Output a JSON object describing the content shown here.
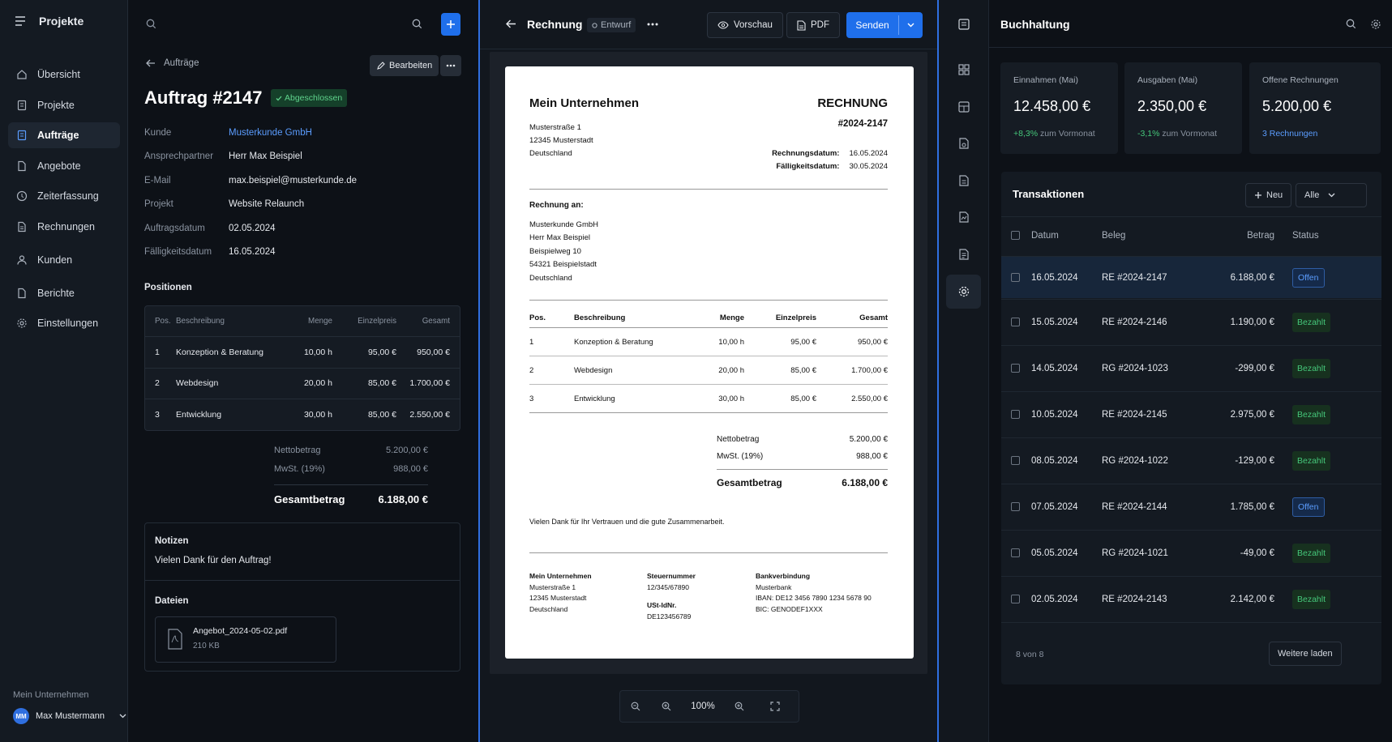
{
  "sidebar": {
    "title": "Projekte",
    "items": [
      {
        "label": "Übersicht",
        "icon": "home-icon"
      },
      {
        "label": "Projekte",
        "icon": "folder-icon"
      },
      {
        "label": "Aufträge",
        "icon": "order-icon"
      },
      {
        "label": "Angebote",
        "icon": "document-icon"
      },
      {
        "label": "Zeiterfassung",
        "icon": "clock-icon"
      },
      {
        "label": "Rechnungen",
        "icon": "invoice-icon"
      },
      {
        "label": "Kunden",
        "icon": "users-icon"
      },
      {
        "label": "Berichte",
        "icon": "report-icon"
      },
      {
        "label": "Einstellungen",
        "icon": "gear-icon"
      }
    ],
    "company": "Mein Unternehmen",
    "user_initials": "MM",
    "user_name": "Max Mustermann"
  },
  "order": {
    "back_label": "Aufträge",
    "edit_label": "Bearbeiten",
    "title": "Auftrag #2147",
    "status": "Abgeschlossen",
    "fields": [
      {
        "key": "Kunde",
        "value": "Musterkunde GmbH"
      },
      {
        "key": "Ansprechpartner",
        "value": "Herr Max Beispiel"
      },
      {
        "key": "E-Mail",
        "value": "max.beispiel@musterkunde.de"
      },
      {
        "key": "Projekt",
        "value": "Website Relaunch"
      },
      {
        "key": "Auftragsdatum",
        "value": "02.05.2024"
      },
      {
        "key": "Fälligkeitsdatum",
        "value": "16.05.2024"
      }
    ],
    "positions_title": "Positionen",
    "table_headers": [
      "Pos.",
      "Beschreibung",
      "Menge",
      "Einzelpreis",
      "Gesamt"
    ],
    "rows": [
      [
        "1",
        "Konzeption & Beratung",
        "10,00 h",
        "95,00 €",
        "950,00 €"
      ],
      [
        "2",
        "Webdesign",
        "20,00 h",
        "85,00 €",
        "1.700,00 €"
      ],
      [
        "3",
        "Entwicklung",
        "30,00 h",
        "85,00 €",
        "2.550,00 €"
      ]
    ],
    "net_label": "Nettobetrag",
    "net_value": "5.200,00 €",
    "vat_label": "MwSt. (19%)",
    "vat_value": "988,00 €",
    "total_label": "Gesamtbetrag",
    "total_value": "6.188,00 €",
    "notes_title": "Notizen",
    "notes_text": "Vielen Dank für den Auftrag!",
    "files_title": "Dateien",
    "file_name": "Angebot_2024-05-02.pdf",
    "file_size": "210 KB"
  },
  "document": {
    "title": "Rechnung",
    "status": "Entwurf",
    "preview_label": "Vorschau",
    "pdf_label": "PDF",
    "send_label": "Senden",
    "zoom": "100%",
    "invoice": {
      "company": "Mein Unternehmen",
      "address": [
        "Musterstraße 1",
        "12345 Musterstadt",
        "Deutschland"
      ],
      "heading": "RECHNUNG",
      "number": "#2024-2147",
      "date_label": "Rechnungsdatum:",
      "date_value": "16.05.2024",
      "due_label": "Fälligkeitsdatum:",
      "due_value": "30.05.2024",
      "to_label": "Rechnung an:",
      "recipient": [
        "Musterkunde GmbH",
        "Herr Max Beispiel",
        "Beispielweg 10",
        "54321 Beispielstadt",
        "Deutschland"
      ],
      "headers": [
        "Pos.",
        "Beschreibung",
        "Menge",
        "Einzelpreis",
        "Gesamt"
      ],
      "rows": [
        [
          "1",
          "Konzeption & Beratung",
          "10,00 h",
          "95,00 €",
          "950,00 €"
        ],
        [
          "2",
          "Webdesign",
          "20,00 h",
          "85,00 €",
          "1.700,00 €"
        ],
        [
          "3",
          "Entwicklung",
          "30,00 h",
          "85,00 €",
          "2.550,00 €"
        ]
      ],
      "net_label": "Nettobetrag",
      "net_value": "5.200,00 €",
      "vat_label": "MwSt. (19%)",
      "vat_value": "988,00 €",
      "total_label": "Gesamtbetrag",
      "total_value": "6.188,00 €",
      "thanks": "Vielen Dank für Ihr Vertrauen und die gute Zusammenarbeit.",
      "footer_company": "Mein Unternehmen",
      "footer_address": [
        "Musterstraße 1",
        "12345 Musterstadt",
        "Deutschland"
      ],
      "tax_label": "Steuernummer",
      "tax_value": "12/345/67890",
      "vatid_label": "USt-IdNr.",
      "vatid_value": "DE123456789",
      "bank_label": "Bankverbindung",
      "bank_lines": [
        "Musterbank",
        "IBAN: DE12 3456 7890 1234 5678 90",
        "BIC: GENODEF1XXX"
      ]
    }
  },
  "books": {
    "title": "Buchhaltung",
    "kpis": [
      {
        "label": "Einnahmen (Mai)",
        "value": "12.458,00 €",
        "delta": "+8,3%",
        "sub": "zum Vormonat",
        "color": "#45c77a"
      },
      {
        "label": "Ausgaben (Mai)",
        "value": "2.350,00 €",
        "delta": "-3,1%",
        "sub": "zum Vormonat",
        "color": "#45c77a"
      },
      {
        "label": "Offene Rechnungen",
        "value": "5.200,00 €",
        "delta": "3 Rechnungen",
        "sub": "",
        "color": "#5b9dff"
      }
    ],
    "transactions_title": "Transaktionen",
    "new_label": "Neu",
    "filter_label": "Alle",
    "headers": [
      "Datum",
      "Beleg",
      "Betrag",
      "Status"
    ],
    "rows": [
      {
        "date": "16.05.2024",
        "ref": "RE #2024-2147",
        "amount": "6.188,00 €",
        "status": "Offen",
        "kind": "open"
      },
      {
        "date": "15.05.2024",
        "ref": "RE #2024-2146",
        "amount": "1.190,00 €",
        "status": "Bezahlt",
        "kind": "paid"
      },
      {
        "date": "14.05.2024",
        "ref": "RG #2024-1023",
        "amount": "-299,00 €",
        "status": "Bezahlt",
        "kind": "paid"
      },
      {
        "date": "10.05.2024",
        "ref": "RE #2024-2145",
        "amount": "2.975,00 €",
        "status": "Bezahlt",
        "kind": "paid"
      },
      {
        "date": "08.05.2024",
        "ref": "RG #2024-1022",
        "amount": "-129,00 €",
        "status": "Bezahlt",
        "kind": "paid"
      },
      {
        "date": "07.05.2024",
        "ref": "RE #2024-2144",
        "amount": "1.785,00 €",
        "status": "Offen",
        "kind": "open"
      },
      {
        "date": "05.05.2024",
        "ref": "RG #2024-1021",
        "amount": "-49,00 €",
        "status": "Bezahlt",
        "kind": "paid"
      },
      {
        "date": "02.05.2024",
        "ref": "RE #2024-2143",
        "amount": "2.142,00 €",
        "status": "Bezahlt",
        "kind": "paid"
      }
    ],
    "count_label": "8 von 8",
    "load_more_label": "Weitere laden"
  }
}
